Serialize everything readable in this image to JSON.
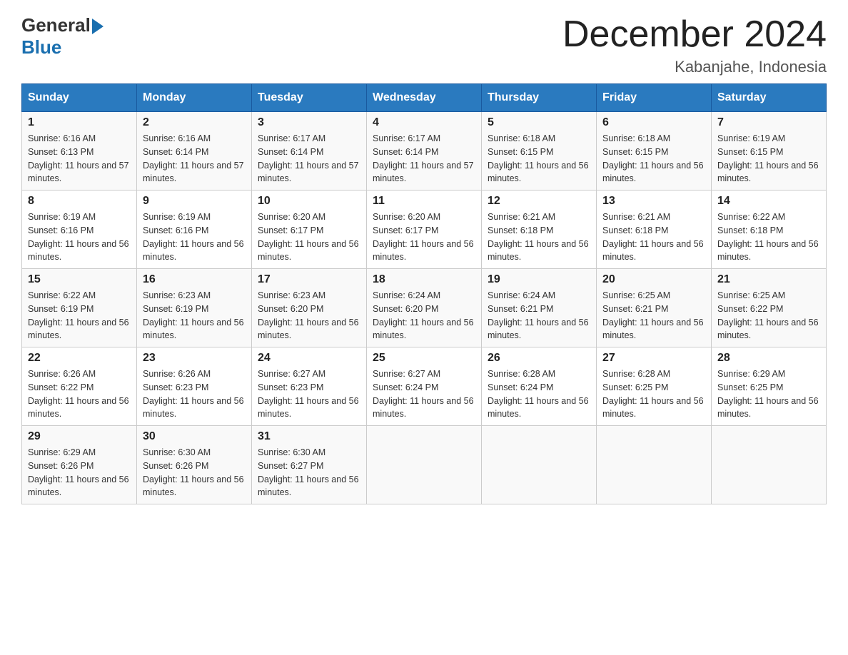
{
  "header": {
    "logo_general": "General",
    "logo_blue": "Blue",
    "month_title": "December 2024",
    "location": "Kabanjahe, Indonesia"
  },
  "days_of_week": [
    "Sunday",
    "Monday",
    "Tuesday",
    "Wednesday",
    "Thursday",
    "Friday",
    "Saturday"
  ],
  "weeks": [
    [
      {
        "day": "1",
        "sunrise": "6:16 AM",
        "sunset": "6:13 PM",
        "daylight": "11 hours and 57 minutes."
      },
      {
        "day": "2",
        "sunrise": "6:16 AM",
        "sunset": "6:14 PM",
        "daylight": "11 hours and 57 minutes."
      },
      {
        "day": "3",
        "sunrise": "6:17 AM",
        "sunset": "6:14 PM",
        "daylight": "11 hours and 57 minutes."
      },
      {
        "day": "4",
        "sunrise": "6:17 AM",
        "sunset": "6:14 PM",
        "daylight": "11 hours and 57 minutes."
      },
      {
        "day": "5",
        "sunrise": "6:18 AM",
        "sunset": "6:15 PM",
        "daylight": "11 hours and 56 minutes."
      },
      {
        "day": "6",
        "sunrise": "6:18 AM",
        "sunset": "6:15 PM",
        "daylight": "11 hours and 56 minutes."
      },
      {
        "day": "7",
        "sunrise": "6:19 AM",
        "sunset": "6:15 PM",
        "daylight": "11 hours and 56 minutes."
      }
    ],
    [
      {
        "day": "8",
        "sunrise": "6:19 AM",
        "sunset": "6:16 PM",
        "daylight": "11 hours and 56 minutes."
      },
      {
        "day": "9",
        "sunrise": "6:19 AM",
        "sunset": "6:16 PM",
        "daylight": "11 hours and 56 minutes."
      },
      {
        "day": "10",
        "sunrise": "6:20 AM",
        "sunset": "6:17 PM",
        "daylight": "11 hours and 56 minutes."
      },
      {
        "day": "11",
        "sunrise": "6:20 AM",
        "sunset": "6:17 PM",
        "daylight": "11 hours and 56 minutes."
      },
      {
        "day": "12",
        "sunrise": "6:21 AM",
        "sunset": "6:18 PM",
        "daylight": "11 hours and 56 minutes."
      },
      {
        "day": "13",
        "sunrise": "6:21 AM",
        "sunset": "6:18 PM",
        "daylight": "11 hours and 56 minutes."
      },
      {
        "day": "14",
        "sunrise": "6:22 AM",
        "sunset": "6:18 PM",
        "daylight": "11 hours and 56 minutes."
      }
    ],
    [
      {
        "day": "15",
        "sunrise": "6:22 AM",
        "sunset": "6:19 PM",
        "daylight": "11 hours and 56 minutes."
      },
      {
        "day": "16",
        "sunrise": "6:23 AM",
        "sunset": "6:19 PM",
        "daylight": "11 hours and 56 minutes."
      },
      {
        "day": "17",
        "sunrise": "6:23 AM",
        "sunset": "6:20 PM",
        "daylight": "11 hours and 56 minutes."
      },
      {
        "day": "18",
        "sunrise": "6:24 AM",
        "sunset": "6:20 PM",
        "daylight": "11 hours and 56 minutes."
      },
      {
        "day": "19",
        "sunrise": "6:24 AM",
        "sunset": "6:21 PM",
        "daylight": "11 hours and 56 minutes."
      },
      {
        "day": "20",
        "sunrise": "6:25 AM",
        "sunset": "6:21 PM",
        "daylight": "11 hours and 56 minutes."
      },
      {
        "day": "21",
        "sunrise": "6:25 AM",
        "sunset": "6:22 PM",
        "daylight": "11 hours and 56 minutes."
      }
    ],
    [
      {
        "day": "22",
        "sunrise": "6:26 AM",
        "sunset": "6:22 PM",
        "daylight": "11 hours and 56 minutes."
      },
      {
        "day": "23",
        "sunrise": "6:26 AM",
        "sunset": "6:23 PM",
        "daylight": "11 hours and 56 minutes."
      },
      {
        "day": "24",
        "sunrise": "6:27 AM",
        "sunset": "6:23 PM",
        "daylight": "11 hours and 56 minutes."
      },
      {
        "day": "25",
        "sunrise": "6:27 AM",
        "sunset": "6:24 PM",
        "daylight": "11 hours and 56 minutes."
      },
      {
        "day": "26",
        "sunrise": "6:28 AM",
        "sunset": "6:24 PM",
        "daylight": "11 hours and 56 minutes."
      },
      {
        "day": "27",
        "sunrise": "6:28 AM",
        "sunset": "6:25 PM",
        "daylight": "11 hours and 56 minutes."
      },
      {
        "day": "28",
        "sunrise": "6:29 AM",
        "sunset": "6:25 PM",
        "daylight": "11 hours and 56 minutes."
      }
    ],
    [
      {
        "day": "29",
        "sunrise": "6:29 AM",
        "sunset": "6:26 PM",
        "daylight": "11 hours and 56 minutes."
      },
      {
        "day": "30",
        "sunrise": "6:30 AM",
        "sunset": "6:26 PM",
        "daylight": "11 hours and 56 minutes."
      },
      {
        "day": "31",
        "sunrise": "6:30 AM",
        "sunset": "6:27 PM",
        "daylight": "11 hours and 56 minutes."
      },
      null,
      null,
      null,
      null
    ]
  ]
}
